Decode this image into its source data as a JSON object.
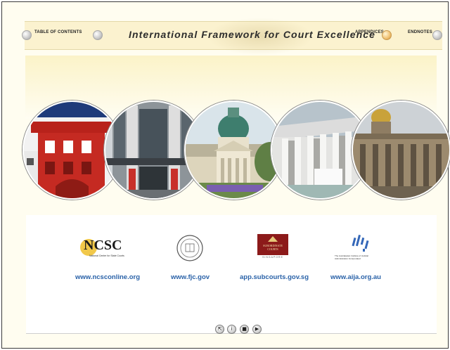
{
  "header": {
    "title": "International Framework for Court Excellence",
    "links": {
      "toc": "TABLE OF CONTENTS",
      "appendices": "APPENDICES",
      "endnotes": "ENDNOTES"
    }
  },
  "partners": [
    {
      "logo_text": "NCSC",
      "logo_sub": "National Center for State Courts",
      "url": "www.ncsconline.org"
    },
    {
      "logo_text": "",
      "logo_sub": "",
      "url": "www.fjc.gov"
    },
    {
      "logo_text": "SUBORDINATE COURTS",
      "logo_sub": "SINGAPORE",
      "url": "app.subcourts.gov.sg"
    },
    {
      "logo_text": "",
      "logo_sub": "The Australasian Institute of Judicial Administration Incorporated",
      "url": "www.aija.org.au"
    }
  ],
  "nav": {
    "first": "⇱",
    "info": "i",
    "stop": "■",
    "next": "▶"
  },
  "colors": {
    "accent_link": "#2a62a8",
    "header_bg": "#fbf2cf",
    "band_top": "#fbf3c8",
    "subcourts_red": "#8c1a1a"
  }
}
